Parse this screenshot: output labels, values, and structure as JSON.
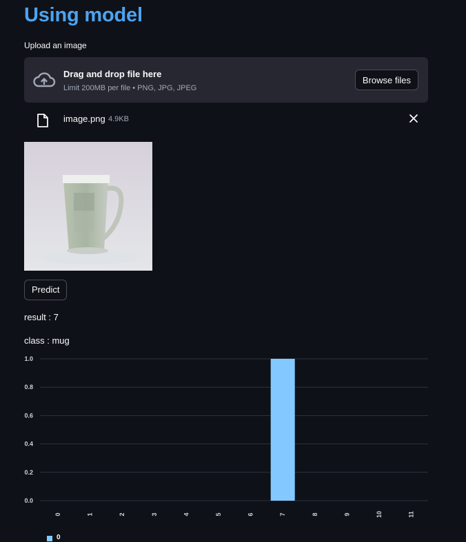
{
  "page": {
    "title": "Using model"
  },
  "uploader": {
    "label": "Upload an image",
    "drop_title": "Drag and drop file here",
    "drop_subtitle": "Limit 200MB per file • PNG, JPG, JPEG",
    "browse_label": "Browse files",
    "icon": "cloud-upload-icon"
  },
  "file": {
    "name": "image.png",
    "size": "4.9KB",
    "icon": "file-icon",
    "remove_icon": "close-icon"
  },
  "preview": {
    "description_icon": "mug-image"
  },
  "actions": {
    "predict_label": "Predict"
  },
  "output": {
    "result": "result : 7",
    "class": "class : mug"
  },
  "chart_data": {
    "type": "bar",
    "categories": [
      "0",
      "1",
      "2",
      "3",
      "4",
      "5",
      "6",
      "7",
      "8",
      "9",
      "10",
      "11"
    ],
    "series": [
      {
        "name": "0",
        "values": [
          0,
          0,
          0,
          0,
          0,
          0,
          0,
          1,
          0,
          0,
          0,
          0
        ],
        "color": "#83c9ff"
      }
    ],
    "yticks": [
      "0.0",
      "0.2",
      "0.4",
      "0.6",
      "0.8",
      "1.0"
    ],
    "ylim": [
      0,
      1
    ],
    "grid": true,
    "legend": "bottom-left"
  }
}
